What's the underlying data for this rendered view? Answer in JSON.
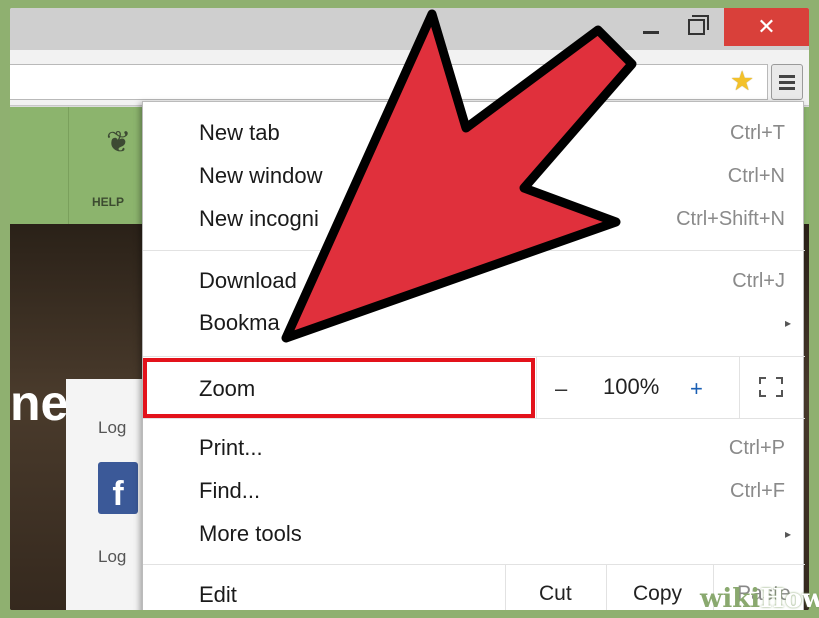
{
  "window": {
    "close_glyph": "✕"
  },
  "site": {
    "nav_help": "HELP",
    "hero_text": "net",
    "login_text_1": "Log",
    "login_text_2": "Log",
    "facebook_glyph": "f"
  },
  "menu": {
    "new_tab": {
      "label": "New tab",
      "shortcut": "Ctrl+T"
    },
    "new_window": {
      "label": "New window",
      "shortcut": "Ctrl+N"
    },
    "new_incognito": {
      "label": "New incogni",
      "shortcut": "Ctrl+Shift+N"
    },
    "downloads": {
      "label": "Download",
      "shortcut": "Ctrl+J"
    },
    "bookmarks": {
      "label": "Bookma",
      "arrow": "▸"
    },
    "zoom": {
      "label": "Zoom",
      "minus": "–",
      "value": "100%",
      "plus": "+"
    },
    "print": {
      "label": "Print...",
      "shortcut": "Ctrl+P"
    },
    "find": {
      "label": "Find...",
      "shortcut": "Ctrl+F"
    },
    "more_tools": {
      "label": "More tools",
      "arrow": "▸"
    },
    "edit": {
      "label": "Edit",
      "cut": "Cut",
      "copy": "Copy",
      "paste": "Paste"
    }
  },
  "watermark": {
    "prefix": "wiki",
    "suffix": "How"
  },
  "colors": {
    "highlight": "#e3121b",
    "arrow_fill": "#e0303c",
    "close_button": "#d9403a",
    "site_green": "#8cb46d"
  },
  "icons": [
    "minimize-icon",
    "maximize-icon",
    "close-icon",
    "star-icon",
    "hamburger-menu-icon",
    "leaf-icon",
    "facebook-icon",
    "fullscreen-icon"
  ]
}
